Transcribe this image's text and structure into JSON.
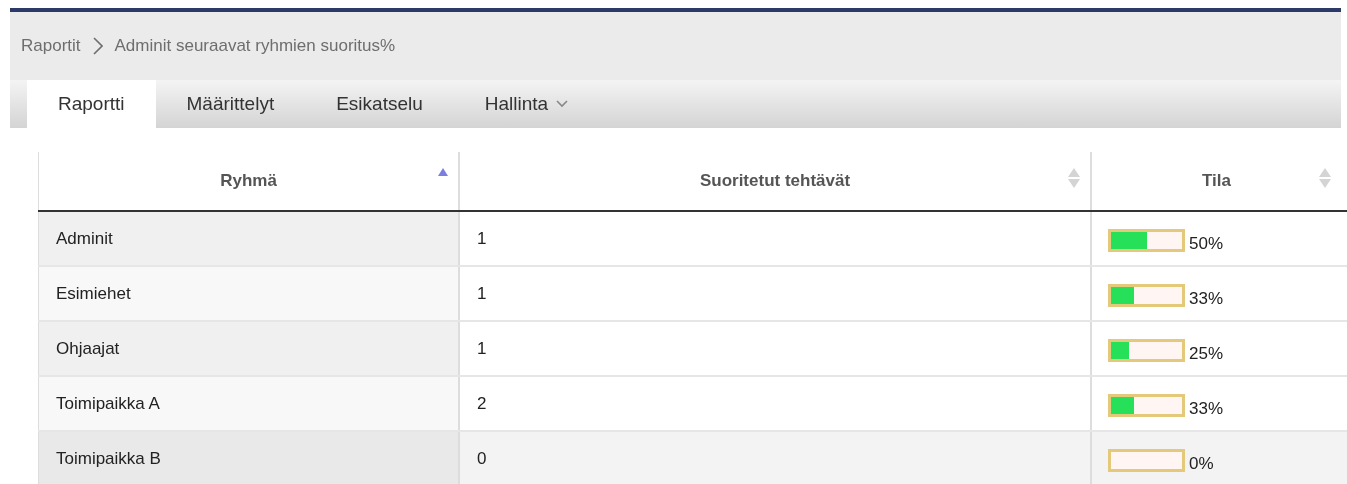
{
  "breadcrumb": [
    "Raportit",
    "Adminit seuraavat ryhmien suoritus%"
  ],
  "tabs": [
    {
      "label": "Raportti",
      "selected": true,
      "dropdown": false
    },
    {
      "label": "Määrittelyt",
      "selected": false,
      "dropdown": false
    },
    {
      "label": "Esikatselu",
      "selected": false,
      "dropdown": false
    },
    {
      "label": "Hallinta",
      "selected": false,
      "dropdown": true
    }
  ],
  "table": {
    "columns": [
      {
        "label": "Ryhmä",
        "sorted": true
      },
      {
        "label": "Suoritetut tehtävät",
        "sorted": false
      },
      {
        "label": "Tila",
        "sorted": false
      }
    ],
    "rows": [
      {
        "group": "Adminit",
        "done": "1",
        "level": 0.5,
        "reading": "50%",
        "highlighted": false
      },
      {
        "group": "Esimiehet",
        "done": "1",
        "level": 0.33,
        "reading": "33%",
        "highlighted": false
      },
      {
        "group": "Ohjaajat",
        "done": "1",
        "level": 0.25,
        "reading": "25%",
        "highlighted": false
      },
      {
        "group": "Toimipaikka A",
        "done": "2",
        "level": 0.33,
        "reading": "33%",
        "highlighted": false
      },
      {
        "group": "Toimipaikka B",
        "done": "0",
        "level": 0,
        "reading": "0%",
        "highlighted": true
      }
    ]
  }
}
